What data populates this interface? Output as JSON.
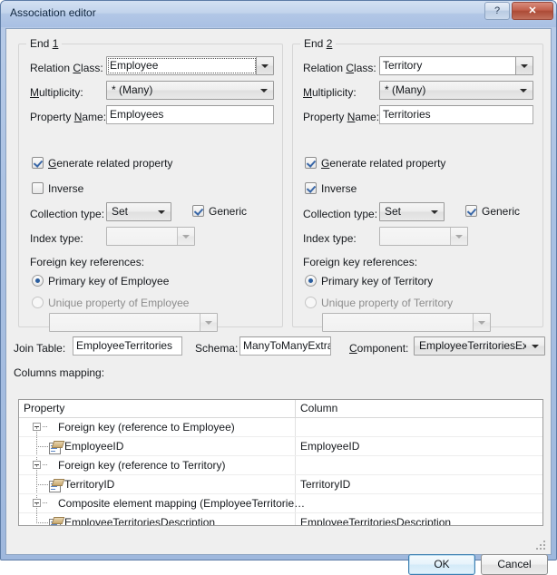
{
  "window": {
    "title": "Association editor",
    "help_button": "?",
    "close_button": "✕"
  },
  "end1": {
    "group_title": "End 1",
    "relation_class_label": "Relation Class:",
    "relation_class_value": "Employee",
    "multiplicity_label": "Multiplicity:",
    "multiplicity_value": "* (Many)",
    "property_name_label": "Property Name:",
    "property_name_value": "Employees",
    "generate_related_label": "Generate related property",
    "generate_related_checked": true,
    "inverse_label": "Inverse",
    "inverse_checked": false,
    "collection_type_label": "Collection type:",
    "collection_type_value": "Set",
    "generic_label": "Generic",
    "generic_checked": true,
    "index_type_label": "Index type:",
    "index_type_value": "",
    "fk_references_label": "Foreign key references:",
    "fk_primary_label": "Primary key of Employee",
    "fk_primary_selected": true,
    "fk_unique_label": "Unique property of Employee",
    "fk_unique_selected": false,
    "unique_property_value": ""
  },
  "end2": {
    "group_title": "End 2",
    "relation_class_label": "Relation Class:",
    "relation_class_value": "Territory",
    "multiplicity_label": "Multiplicity:",
    "multiplicity_value": "* (Many)",
    "property_name_label": "Property Name:",
    "property_name_value": "Territories",
    "generate_related_label": "Generate related property",
    "generate_related_checked": true,
    "inverse_label": "Inverse",
    "inverse_checked": true,
    "collection_type_label": "Collection type:",
    "collection_type_value": "Set",
    "generic_label": "Generic",
    "generic_checked": true,
    "index_type_label": "Index type:",
    "index_type_value": "",
    "fk_references_label": "Foreign key references:",
    "fk_primary_label": "Primary key of Territory",
    "fk_primary_selected": true,
    "fk_unique_label": "Unique property of Territory",
    "fk_unique_selected": false,
    "unique_property_value": ""
  },
  "join": {
    "join_table_label": "Join Table:",
    "join_table_value": "EmployeeTerritories",
    "schema_label": "Schema:",
    "schema_value": "ManyToManyExtra",
    "component_label": "Component:",
    "component_value": "EmployeeTerritoriesExtra"
  },
  "mapping": {
    "section_label": "Columns mapping:",
    "headers": [
      "Property",
      "Column"
    ],
    "rows": [
      {
        "level": 0,
        "property": "Foreign key (reference to Employee)",
        "column": "",
        "icon": ""
      },
      {
        "level": 1,
        "property": "EmployeeID",
        "column": "EmployeeID",
        "icon": "property-icon"
      },
      {
        "level": 0,
        "property": "Foreign key (reference to Territory)",
        "column": "",
        "icon": ""
      },
      {
        "level": 1,
        "property": "TerritoryID",
        "column": "TerritoryID",
        "icon": "property-icon"
      },
      {
        "level": 0,
        "property": "Composite element mapping (EmployeeTerritorie…",
        "column": "",
        "icon": ""
      },
      {
        "level": 1,
        "property": "EmployeeTerritoriesDescription",
        "column": "EmployeeTerritoriesDescription",
        "icon": "property-icon"
      }
    ]
  },
  "footer": {
    "ok_label": "OK",
    "cancel_label": "Cancel"
  },
  "colors": {
    "titlebar_blue": "#b2c7e6",
    "close_red": "#ac4b36",
    "client_grey": "#efefef",
    "accent_blue": "#3c7fb1"
  }
}
